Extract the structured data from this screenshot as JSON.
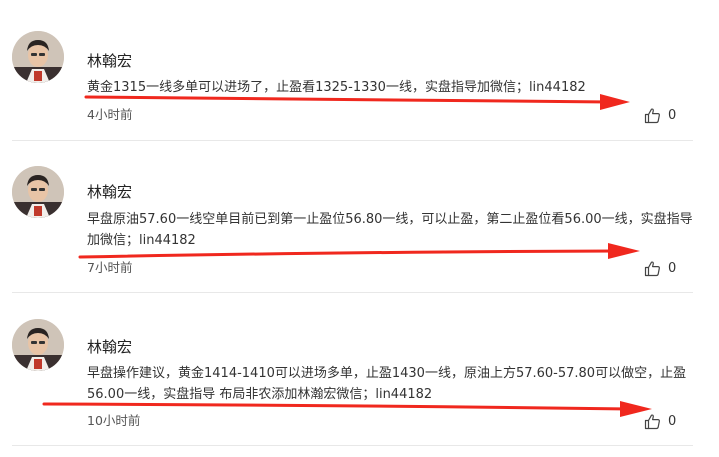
{
  "posts": [
    {
      "author": "林翰宏",
      "content": "黄金1315一线多单可以进场了，止盈看1325-1330一线，实盘指导加微信；lin44182",
      "time": "4小时前",
      "likes": "0"
    },
    {
      "author": "林翰宏",
      "content": "早盘原油57.60一线空单目前已到第一止盈位56.80一线，可以止盈，第二止盈位看56.00一线，实盘指导加微信；lin44182",
      "time": "7小时前",
      "likes": "0"
    },
    {
      "author": "林翰宏",
      "content": "早盘操作建议，黄金1414-1410可以进场多单，止盈1430一线，原油上方57.60-57.80可以做空，止盈56.00一线，实盘指导 布局非农添加林瀚宏微信；lin44182",
      "time": "10小时前",
      "likes": "0"
    }
  ],
  "colors": {
    "annotation_arrow": "#f0281e",
    "divider": "#e8e8e8"
  },
  "icons": {
    "like": "thumbs-up-icon",
    "avatar": "avatar"
  }
}
